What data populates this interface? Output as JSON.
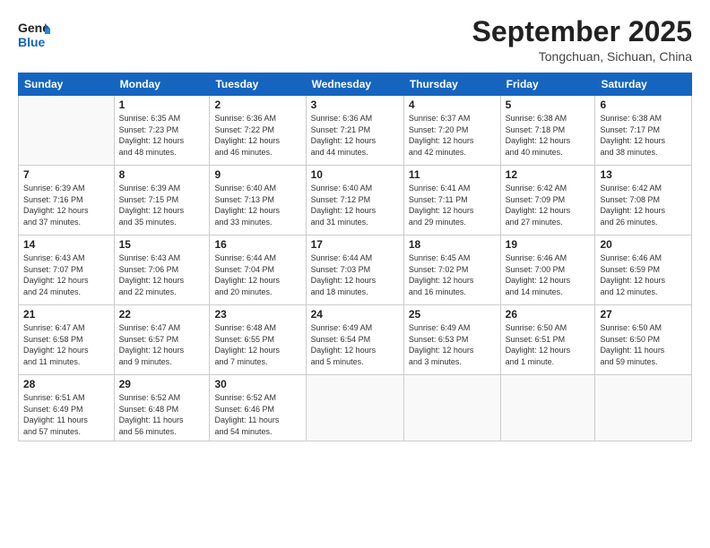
{
  "logo": {
    "line1": "General",
    "line2": "Blue"
  },
  "header": {
    "month": "September 2025",
    "location": "Tongchuan, Sichuan, China"
  },
  "weekdays": [
    "Sunday",
    "Monday",
    "Tuesday",
    "Wednesday",
    "Thursday",
    "Friday",
    "Saturday"
  ],
  "weeks": [
    [
      {
        "day": "",
        "info": ""
      },
      {
        "day": "1",
        "info": "Sunrise: 6:35 AM\nSunset: 7:23 PM\nDaylight: 12 hours\nand 48 minutes."
      },
      {
        "day": "2",
        "info": "Sunrise: 6:36 AM\nSunset: 7:22 PM\nDaylight: 12 hours\nand 46 minutes."
      },
      {
        "day": "3",
        "info": "Sunrise: 6:36 AM\nSunset: 7:21 PM\nDaylight: 12 hours\nand 44 minutes."
      },
      {
        "day": "4",
        "info": "Sunrise: 6:37 AM\nSunset: 7:20 PM\nDaylight: 12 hours\nand 42 minutes."
      },
      {
        "day": "5",
        "info": "Sunrise: 6:38 AM\nSunset: 7:18 PM\nDaylight: 12 hours\nand 40 minutes."
      },
      {
        "day": "6",
        "info": "Sunrise: 6:38 AM\nSunset: 7:17 PM\nDaylight: 12 hours\nand 38 minutes."
      }
    ],
    [
      {
        "day": "7",
        "info": "Sunrise: 6:39 AM\nSunset: 7:16 PM\nDaylight: 12 hours\nand 37 minutes."
      },
      {
        "day": "8",
        "info": "Sunrise: 6:39 AM\nSunset: 7:15 PM\nDaylight: 12 hours\nand 35 minutes."
      },
      {
        "day": "9",
        "info": "Sunrise: 6:40 AM\nSunset: 7:13 PM\nDaylight: 12 hours\nand 33 minutes."
      },
      {
        "day": "10",
        "info": "Sunrise: 6:40 AM\nSunset: 7:12 PM\nDaylight: 12 hours\nand 31 minutes."
      },
      {
        "day": "11",
        "info": "Sunrise: 6:41 AM\nSunset: 7:11 PM\nDaylight: 12 hours\nand 29 minutes."
      },
      {
        "day": "12",
        "info": "Sunrise: 6:42 AM\nSunset: 7:09 PM\nDaylight: 12 hours\nand 27 minutes."
      },
      {
        "day": "13",
        "info": "Sunrise: 6:42 AM\nSunset: 7:08 PM\nDaylight: 12 hours\nand 26 minutes."
      }
    ],
    [
      {
        "day": "14",
        "info": "Sunrise: 6:43 AM\nSunset: 7:07 PM\nDaylight: 12 hours\nand 24 minutes."
      },
      {
        "day": "15",
        "info": "Sunrise: 6:43 AM\nSunset: 7:06 PM\nDaylight: 12 hours\nand 22 minutes."
      },
      {
        "day": "16",
        "info": "Sunrise: 6:44 AM\nSunset: 7:04 PM\nDaylight: 12 hours\nand 20 minutes."
      },
      {
        "day": "17",
        "info": "Sunrise: 6:44 AM\nSunset: 7:03 PM\nDaylight: 12 hours\nand 18 minutes."
      },
      {
        "day": "18",
        "info": "Sunrise: 6:45 AM\nSunset: 7:02 PM\nDaylight: 12 hours\nand 16 minutes."
      },
      {
        "day": "19",
        "info": "Sunrise: 6:46 AM\nSunset: 7:00 PM\nDaylight: 12 hours\nand 14 minutes."
      },
      {
        "day": "20",
        "info": "Sunrise: 6:46 AM\nSunset: 6:59 PM\nDaylight: 12 hours\nand 12 minutes."
      }
    ],
    [
      {
        "day": "21",
        "info": "Sunrise: 6:47 AM\nSunset: 6:58 PM\nDaylight: 12 hours\nand 11 minutes."
      },
      {
        "day": "22",
        "info": "Sunrise: 6:47 AM\nSunset: 6:57 PM\nDaylight: 12 hours\nand 9 minutes."
      },
      {
        "day": "23",
        "info": "Sunrise: 6:48 AM\nSunset: 6:55 PM\nDaylight: 12 hours\nand 7 minutes."
      },
      {
        "day": "24",
        "info": "Sunrise: 6:49 AM\nSunset: 6:54 PM\nDaylight: 12 hours\nand 5 minutes."
      },
      {
        "day": "25",
        "info": "Sunrise: 6:49 AM\nSunset: 6:53 PM\nDaylight: 12 hours\nand 3 minutes."
      },
      {
        "day": "26",
        "info": "Sunrise: 6:50 AM\nSunset: 6:51 PM\nDaylight: 12 hours\nand 1 minute."
      },
      {
        "day": "27",
        "info": "Sunrise: 6:50 AM\nSunset: 6:50 PM\nDaylight: 11 hours\nand 59 minutes."
      }
    ],
    [
      {
        "day": "28",
        "info": "Sunrise: 6:51 AM\nSunset: 6:49 PM\nDaylight: 11 hours\nand 57 minutes."
      },
      {
        "day": "29",
        "info": "Sunrise: 6:52 AM\nSunset: 6:48 PM\nDaylight: 11 hours\nand 56 minutes."
      },
      {
        "day": "30",
        "info": "Sunrise: 6:52 AM\nSunset: 6:46 PM\nDaylight: 11 hours\nand 54 minutes."
      },
      {
        "day": "",
        "info": ""
      },
      {
        "day": "",
        "info": ""
      },
      {
        "day": "",
        "info": ""
      },
      {
        "day": "",
        "info": ""
      }
    ]
  ]
}
